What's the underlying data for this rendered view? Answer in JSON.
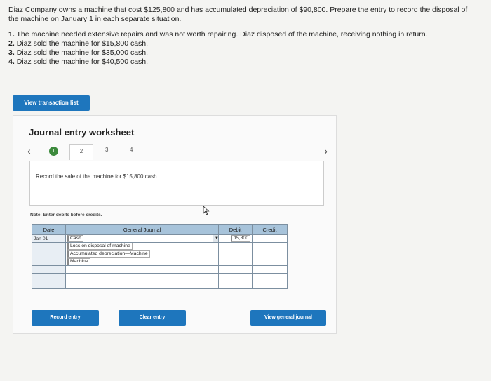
{
  "problem": {
    "intro": "Diaz Company owns a machine that cost $125,800 and has accumulated depreciation of $90,800. Prepare the entry to record the disposal of the machine on January 1 in each separate situation.",
    "parts": [
      {
        "num": "1.",
        "text": "The machine needed extensive repairs and was not worth repairing. Diaz disposed of the machine, receiving nothing in return."
      },
      {
        "num": "2.",
        "text": "Diaz sold the machine for $15,800 cash."
      },
      {
        "num": "3.",
        "text": "Diaz sold the machine for $35,000 cash."
      },
      {
        "num": "4.",
        "text": "Diaz sold the machine for $40,500 cash."
      }
    ]
  },
  "buttons": {
    "view_transactions": "View transaction list",
    "record_entry": "Record entry",
    "clear_entry": "Clear entry",
    "view_general_journal": "View general journal"
  },
  "worksheet": {
    "title": "Journal entry worksheet",
    "steps": [
      "1",
      "2",
      "3",
      "4"
    ],
    "prompt": "Record the sale of the machine for $15,800 cash.",
    "note": "Note: Enter debits before credits."
  },
  "journal": {
    "headers": {
      "date": "Date",
      "general_journal": "General Journal",
      "debit": "Debit",
      "credit": "Credit"
    },
    "rows": [
      {
        "date": "Jan 01",
        "account": "Cash",
        "debit": "15,800",
        "credit": ""
      },
      {
        "date": "",
        "account": "Loss on disposal of machine",
        "debit": "",
        "credit": ""
      },
      {
        "date": "",
        "account": "Accumulated depreciation—Machine",
        "debit": "",
        "credit": ""
      },
      {
        "date": "",
        "account": "Machine",
        "debit": "",
        "credit": ""
      },
      {
        "date": "",
        "account": "",
        "debit": "",
        "credit": ""
      },
      {
        "date": "",
        "account": "",
        "debit": "",
        "credit": ""
      },
      {
        "date": "",
        "account": "",
        "debit": "",
        "credit": ""
      }
    ]
  },
  "colors": {
    "accent_button": "#1e76bd",
    "step_complete": "#3c8a3c",
    "table_header": "#a7c3da"
  }
}
